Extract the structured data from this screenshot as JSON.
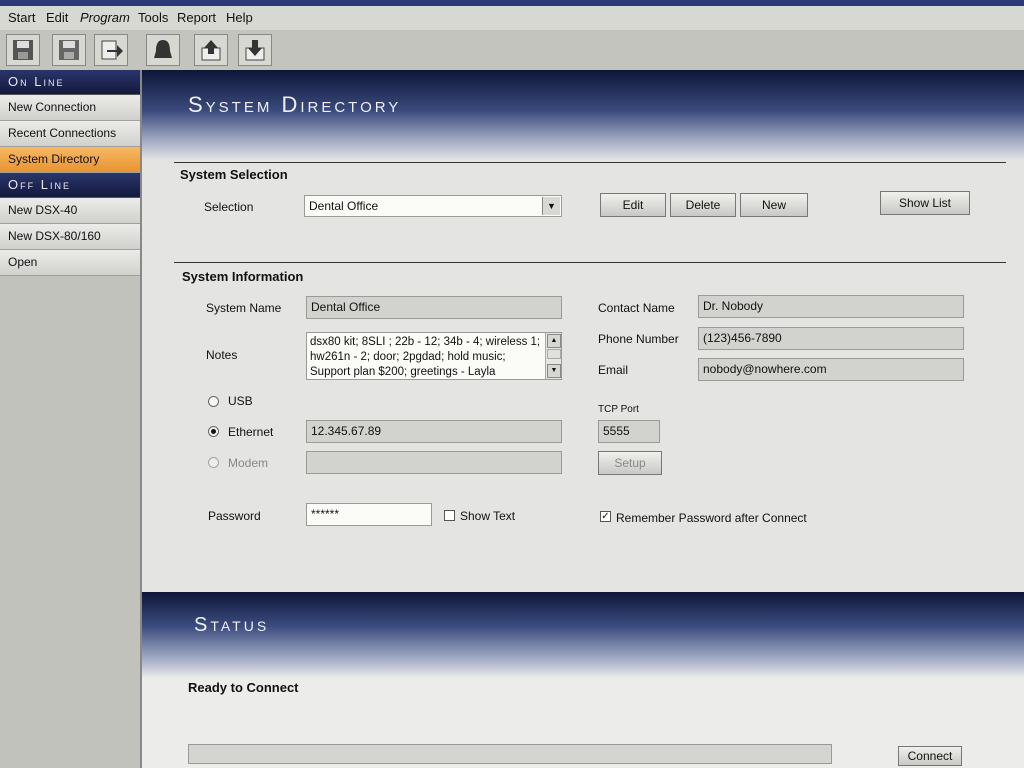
{
  "menu": [
    "Start",
    "Edit",
    "Program",
    "Tools",
    "Report",
    "Help"
  ],
  "toolbar_icons": [
    "save-icon",
    "save-as-icon",
    "export-icon",
    "bell-icon",
    "upload-icon",
    "download-icon"
  ],
  "sidebar": {
    "online_header": "On Line",
    "online_items": [
      "New Connection",
      "Recent Connections",
      "System Directory"
    ],
    "offline_header": "Off Line",
    "offline_items": [
      "New DSX-40",
      "New DSX-80/160",
      "Open"
    ]
  },
  "page": {
    "title": "System Directory"
  },
  "selection": {
    "section_title": "System Selection",
    "label": "Selection",
    "value": "Dental Office",
    "buttons": {
      "edit": "Edit",
      "delete": "Delete",
      "new": "New",
      "show_list": "Show List"
    }
  },
  "info": {
    "section_title": "System Information",
    "system_name_label": "System Name",
    "system_name": "Dental Office",
    "notes_label": "Notes",
    "notes": "dsx80 kit; 8SLI ; 22b - 12; 34b - 4; wireless 1; hw261n - 2; door; 2pgdad; hold music; Support plan $200; greetings - Layla",
    "contact_name_label": "Contact Name",
    "contact_name": "Dr. Nobody",
    "phone_label": "Phone Number",
    "phone": "(123)456-7890",
    "email_label": "Email",
    "email": "nobody@nowhere.com",
    "usb_label": "USB",
    "ethernet_label": "Ethernet",
    "ethernet_value": "12.345.67.89",
    "modem_label": "Modem",
    "modem_value": "",
    "tcp_port_label": "TCP Port",
    "tcp_port": "5555",
    "setup_button": "Setup",
    "password_label": "Password",
    "password": "******",
    "show_text_label": "Show Text",
    "remember_label": "Remember Password after Connect"
  },
  "status": {
    "title": "Status",
    "message": "Ready to Connect",
    "connect_button": "Connect"
  }
}
